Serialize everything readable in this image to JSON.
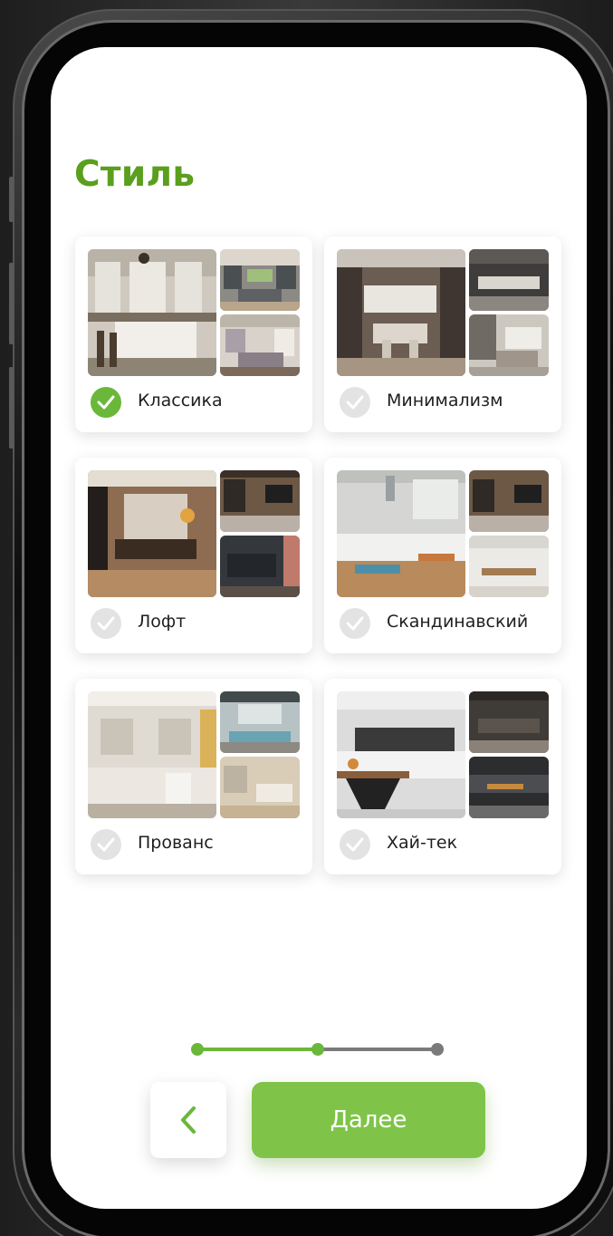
{
  "title": "Стиль",
  "styles": [
    {
      "label": "Классика",
      "selected": true
    },
    {
      "label": "Минимализм",
      "selected": false
    },
    {
      "label": "Лофт",
      "selected": false
    },
    {
      "label": "Скандинавский",
      "selected": false
    },
    {
      "label": "Прованс",
      "selected": false
    },
    {
      "label": "Хай-тек",
      "selected": false
    }
  ],
  "progress": {
    "current_step": 2,
    "total_steps": 3
  },
  "back_icon": "chevron-left-icon",
  "next_label": "Далее",
  "colors": {
    "accent": "#5a9f1e",
    "button": "#7fc448",
    "progress_done": "#6ab73a",
    "progress_todo": "#7a7a7a",
    "check_on": "#6ab73a",
    "check_off": "#e3e3e3"
  }
}
